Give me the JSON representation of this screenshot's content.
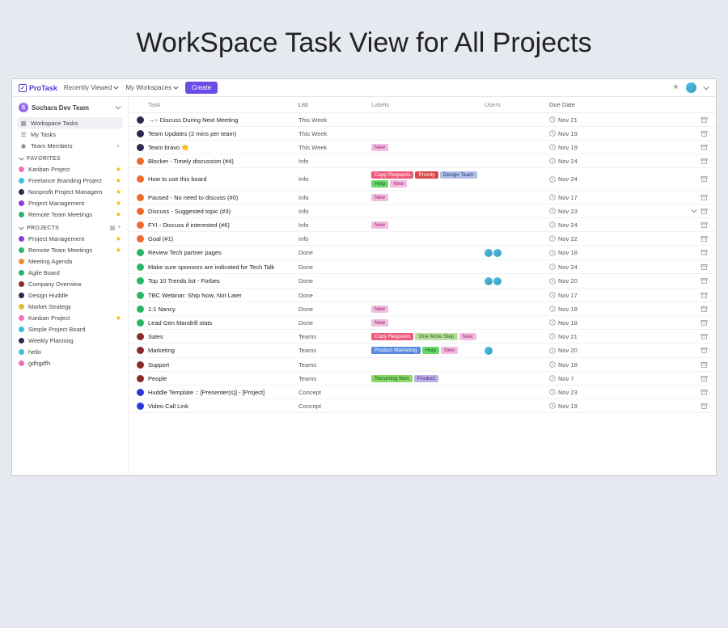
{
  "page_heading": "WorkSpace Task View for All Projects",
  "topbar": {
    "logo_text": "ProTask",
    "recently_viewed": "Recently Viewed",
    "my_workspaces": "My Workspaces",
    "create": "Create"
  },
  "sidebar": {
    "team_initial": "S",
    "team_name": "Sochara Dev Team",
    "nav": {
      "workspace_tasks": "Workspace Tasks",
      "my_tasks": "My Tasks",
      "team_members": "Team Members"
    },
    "favorites_label": "FAVORITES",
    "favorites": [
      {
        "label": "Kanban Project",
        "color": "#f06fbf",
        "starred": true
      },
      {
        "label": "Freelance Branding Project",
        "color": "#3fbfe0",
        "starred": true
      },
      {
        "label": "Nonprofit Project Managem",
        "color": "#2a2a55",
        "starred": true
      },
      {
        "label": "Project Management",
        "color": "#8a3bd8",
        "starred": true
      },
      {
        "label": "Remote Team Meetings",
        "color": "#2ab56b",
        "starred": true
      }
    ],
    "projects_label": "PROJECTS",
    "projects": [
      {
        "label": "Project Management",
        "color": "#8a3bd8",
        "starred": true
      },
      {
        "label": "Remote Team Meetings",
        "color": "#2ab56b",
        "starred": true
      },
      {
        "label": "Meeting Agenda",
        "color": "#f08a2a",
        "starred": false
      },
      {
        "label": "Agile Board",
        "color": "#2ab56b",
        "starred": false
      },
      {
        "label": "Company Overview",
        "color": "#8a2a2a",
        "starred": false
      },
      {
        "label": "Design Huddle",
        "color": "#2a2a55",
        "starred": false
      },
      {
        "label": "Market Strategy",
        "color": "#d8c23b",
        "starred": false
      },
      {
        "label": "Kanban Project",
        "color": "#f06fbf",
        "starred": true
      },
      {
        "label": "Simple Project Board",
        "color": "#3fbfe0",
        "starred": false
      },
      {
        "label": "Weekly Planning",
        "color": "#2a2a55",
        "starred": false
      },
      {
        "label": "hello",
        "color": "#3fbfe0",
        "starred": false
      },
      {
        "label": "gdhgdfh",
        "color": "#f06fbf",
        "starred": false
      }
    ]
  },
  "columns": {
    "task": "Task",
    "list": "List",
    "labels": "Labels",
    "users": "Users",
    "due": "Due Date"
  },
  "tasks": [
    {
      "dot": "#2a2a55",
      "name": "→-- Discuss During Next Meeting",
      "list": "This Week",
      "labels": [],
      "users": 0,
      "due": "Nov 21",
      "dd": false
    },
    {
      "dot": "#2a2a55",
      "name": "Team Updates (2 mins per team)",
      "list": "This Week",
      "labels": [],
      "users": 0,
      "due": "Nov 19",
      "dd": false
    },
    {
      "dot": "#2a2a55",
      "name": "Team bravo 👏",
      "list": "This Week",
      "labels": [
        {
          "text": "New",
          "bg": "#f0bde0",
          "fg": "#a02070"
        }
      ],
      "users": 0,
      "due": "Nov 19",
      "dd": false
    },
    {
      "dot": "#f06a2a",
      "name": "Blocker - Timely discussion (#4)",
      "list": "Info",
      "labels": [],
      "users": 0,
      "due": "Nov 24",
      "dd": false
    },
    {
      "dot": "#f06a2a",
      "name": "How to use this board",
      "list": "Info",
      "labels": [
        {
          "text": "Copy Requests",
          "bg": "#f05a7a",
          "fg": "#fff"
        },
        {
          "text": "Priority",
          "bg": "#d84a4a",
          "fg": "#fff"
        },
        {
          "text": "Design Team",
          "bg": "#b0c0e8",
          "fg": "#2a3a70"
        },
        {
          "text": "Help",
          "bg": "#6ad86a",
          "fg": "#1a5a1a"
        },
        {
          "text": "New",
          "bg": "#f0bde0",
          "fg": "#a02070"
        }
      ],
      "users": 0,
      "due": "Nov 24",
      "dd": false
    },
    {
      "dot": "#f06a2a",
      "name": "Paused - No need to discuss (#0)",
      "list": "Info",
      "labels": [
        {
          "text": "New",
          "bg": "#f0bde0",
          "fg": "#a02070"
        }
      ],
      "users": 0,
      "due": "Nov 17",
      "dd": false
    },
    {
      "dot": "#f06a2a",
      "name": "Discuss - Suggested topic (#3)",
      "list": "Info",
      "labels": [],
      "users": 0,
      "due": "Nov 23",
      "dd": true
    },
    {
      "dot": "#f06a2a",
      "name": "FYI - Discuss if interested (#6)",
      "list": "Info",
      "labels": [
        {
          "text": "New",
          "bg": "#f0bde0",
          "fg": "#a02070"
        }
      ],
      "users": 0,
      "due": "Nov 24",
      "dd": false
    },
    {
      "dot": "#f06a2a",
      "name": "Goal (#1)",
      "list": "Info",
      "labels": [],
      "users": 0,
      "due": "Nov 22",
      "dd": false
    },
    {
      "dot": "#2ab56b",
      "name": "Review Tech partner pages",
      "list": "Done",
      "labels": [],
      "users": 2,
      "due": "Nov 18",
      "dd": false
    },
    {
      "dot": "#2ab56b",
      "name": "Make sure sponsors are indicated for Tech Talk",
      "list": "Done",
      "labels": [],
      "users": 0,
      "due": "Nov 24",
      "dd": false
    },
    {
      "dot": "#2ab56b",
      "name": "Top 10 Trends list - Forbes",
      "list": "Done",
      "labels": [],
      "users": 2,
      "due": "Nov 20",
      "dd": false
    },
    {
      "dot": "#2ab56b",
      "name": "TBC Webinar: Ship Now, Not Later",
      "list": "Done",
      "labels": [],
      "users": 0,
      "due": "Nov 17",
      "dd": false
    },
    {
      "dot": "#2ab56b",
      "name": "1:1 Nancy",
      "list": "Done",
      "labels": [
        {
          "text": "New",
          "bg": "#f0bde0",
          "fg": "#a02070"
        }
      ],
      "users": 0,
      "due": "Nov 18",
      "dd": false
    },
    {
      "dot": "#2ab56b",
      "name": "Lead Gen Mandrill stats",
      "list": "Done",
      "labels": [
        {
          "text": "New",
          "bg": "#f0bde0",
          "fg": "#a02070"
        }
      ],
      "users": 0,
      "due": "Nov 18",
      "dd": false
    },
    {
      "dot": "#8a2a2a",
      "name": "Sales",
      "list": "Teams",
      "labels": [
        {
          "text": "Copy Requests",
          "bg": "#f05a7a",
          "fg": "#fff"
        },
        {
          "text": "One More Step",
          "bg": "#b8e0a0",
          "fg": "#2a5a1a"
        },
        {
          "text": "New",
          "bg": "#f0bde0",
          "fg": "#a02070"
        }
      ],
      "users": 0,
      "due": "Nov 21",
      "dd": false
    },
    {
      "dot": "#8a2a2a",
      "name": "Marketing",
      "list": "Teams",
      "labels": [
        {
          "text": "Product Marketing",
          "bg": "#5a8ae0",
          "fg": "#fff"
        },
        {
          "text": "Help",
          "bg": "#6ad86a",
          "fg": "#1a5a1a"
        },
        {
          "text": "New",
          "bg": "#f0bde0",
          "fg": "#a02070"
        }
      ],
      "users": 1,
      "due": "Nov 20",
      "dd": false
    },
    {
      "dot": "#8a2a2a",
      "name": "Support",
      "list": "Teams",
      "labels": [],
      "users": 0,
      "due": "Nov 18",
      "dd": false
    },
    {
      "dot": "#8a2a2a",
      "name": "People",
      "list": "Teams",
      "labels": [
        {
          "text": "Recurring Item",
          "bg": "#8ad86a",
          "fg": "#1a5a1a"
        },
        {
          "text": "Product",
          "bg": "#c0b0e8",
          "fg": "#4a2a8a"
        }
      ],
      "users": 0,
      "due": "Nov 7",
      "dd": false
    },
    {
      "dot": "#2a3ad8",
      "name": "Huddle Template :: [Presenter(s)] - [Project]",
      "list": "Concept",
      "labels": [],
      "users": 0,
      "due": "Nov 23",
      "dd": false
    },
    {
      "dot": "#2a3ad8",
      "name": "Video Call Link",
      "list": "Concept",
      "labels": [],
      "users": 0,
      "due": "Nov 19",
      "dd": false
    }
  ]
}
